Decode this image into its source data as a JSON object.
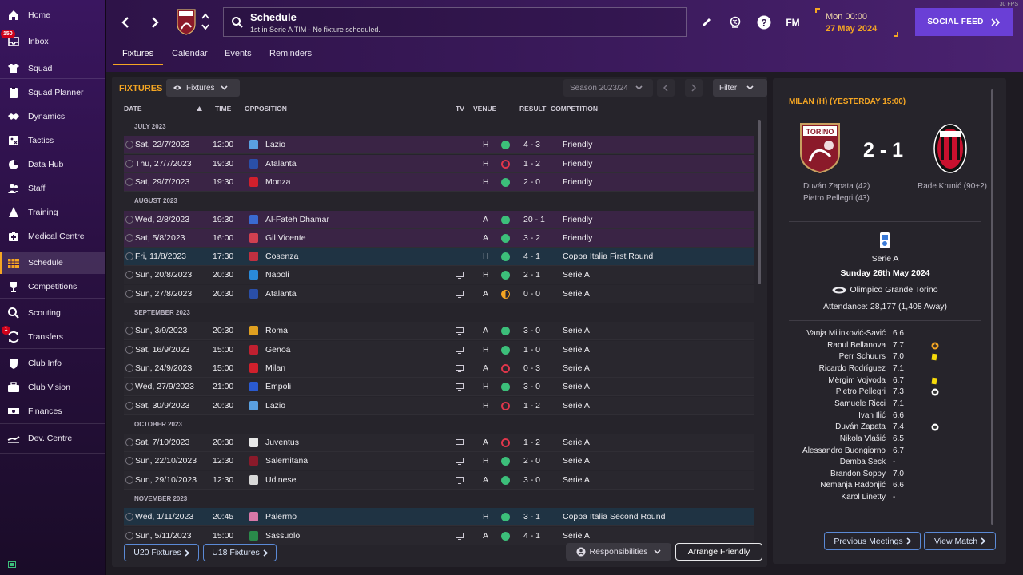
{
  "sidebar": {
    "items": [
      {
        "label": "Home",
        "icon": "home-icon"
      },
      {
        "label": "Inbox",
        "icon": "inbox-icon",
        "badge": "150"
      },
      {
        "label": "Squad",
        "icon": "shirt-icon"
      },
      {
        "label": "Squad Planner",
        "icon": "clipboard-icon"
      },
      {
        "label": "Dynamics",
        "icon": "handshake-icon"
      },
      {
        "label": "Tactics",
        "icon": "tactics-board-icon"
      },
      {
        "label": "Data Hub",
        "icon": "data-hub-icon"
      },
      {
        "label": "Staff",
        "icon": "staff-icon"
      },
      {
        "label": "Training",
        "icon": "training-cone-icon"
      },
      {
        "label": "Medical Centre",
        "icon": "medical-kit-icon"
      },
      {
        "label": "Schedule",
        "icon": "calendar-icon"
      },
      {
        "label": "Competitions",
        "icon": "trophy-icon"
      },
      {
        "label": "Scouting",
        "icon": "magnifier-icon"
      },
      {
        "label": "Transfers",
        "icon": "transfer-arrows-icon",
        "badge": "1"
      },
      {
        "label": "Club Info",
        "icon": "shield-icon"
      },
      {
        "label": "Club Vision",
        "icon": "briefcase-icon"
      },
      {
        "label": "Finances",
        "icon": "money-icon"
      },
      {
        "label": "Dev. Centre",
        "icon": "dev-centre-icon"
      }
    ],
    "active": "Schedule"
  },
  "header": {
    "title": "Schedule",
    "subtitle": "1st in Serie A TIM - No fixture scheduled.",
    "date_time": "Mon 00:00",
    "date": "27 May 2024",
    "social_feed": "SOCIAL FEED",
    "fm_label": "FM",
    "fps": "30 FPS"
  },
  "tabs": [
    "Fixtures",
    "Calendar",
    "Events",
    "Reminders"
  ],
  "fixtures_panel": {
    "title": "FIXTURES",
    "view_dropdown": "Fixtures",
    "season": "Season 2023/24",
    "filter": "Filter",
    "columns": {
      "date": "DATE",
      "time": "TIME",
      "opposition": "OPPOSITION",
      "tv": "TV",
      "venue": "VENUE",
      "result": "RESULT",
      "competition": "COMPETITION"
    },
    "rows": [
      {
        "type": "month",
        "label": "JULY 2023"
      },
      {
        "type": "fixture",
        "style": "friendly",
        "date": "Sat, 22/7/2023",
        "time": "12:00",
        "opposition": "Lazio",
        "crest": "#5aa0e0",
        "tv": false,
        "venue": "H",
        "outcome": "win",
        "result": "4 - 3",
        "competition": "Friendly"
      },
      {
        "type": "fixture",
        "style": "friendly",
        "date": "Thu, 27/7/2023",
        "time": "19:30",
        "opposition": "Atalanta",
        "crest": "#2a4fa8",
        "tv": false,
        "venue": "H",
        "outcome": "loss",
        "result": "1 - 2",
        "competition": "Friendly"
      },
      {
        "type": "fixture",
        "style": "friendly",
        "date": "Sat, 29/7/2023",
        "time": "19:30",
        "opposition": "Monza",
        "crest": "#d0202c",
        "tv": false,
        "venue": "H",
        "outcome": "win",
        "result": "2 - 0",
        "competition": "Friendly"
      },
      {
        "type": "month",
        "label": "AUGUST 2023"
      },
      {
        "type": "fixture",
        "style": "friendly",
        "date": "Wed, 2/8/2023",
        "time": "19:30",
        "opposition": "Al-Fateh Dhamar",
        "crest": "#3a6ad0",
        "tv": false,
        "venue": "A",
        "outcome": "win",
        "result": "20 - 1",
        "competition": "Friendly"
      },
      {
        "type": "fixture",
        "style": "friendly",
        "date": "Sat, 5/8/2023",
        "time": "16:00",
        "opposition": "Gil Vicente",
        "crest": "#d04050",
        "tv": false,
        "venue": "A",
        "outcome": "win",
        "result": "3 - 2",
        "competition": "Friendly"
      },
      {
        "type": "fixture",
        "style": "cup",
        "date": "Fri, 11/8/2023",
        "time": "17:30",
        "opposition": "Cosenza",
        "crest": "#c03040",
        "tv": false,
        "venue": "H",
        "outcome": "win",
        "result": "4 - 1",
        "competition": "Coppa Italia First Round"
      },
      {
        "type": "fixture",
        "style": "league",
        "date": "Sun, 20/8/2023",
        "time": "20:30",
        "opposition": "Napoli",
        "crest": "#2a8ad8",
        "tv": true,
        "venue": "H",
        "outcome": "win",
        "result": "2 - 1",
        "competition": "Serie A"
      },
      {
        "type": "fixture",
        "style": "league",
        "date": "Sun, 27/8/2023",
        "time": "20:30",
        "opposition": "Atalanta",
        "crest": "#2a4fa8",
        "tv": true,
        "venue": "A",
        "outcome": "draw",
        "result": "0 - 0",
        "competition": "Serie A"
      },
      {
        "type": "month",
        "label": "SEPTEMBER 2023"
      },
      {
        "type": "fixture",
        "style": "league",
        "date": "Sun, 3/9/2023",
        "time": "20:30",
        "opposition": "Roma",
        "crest": "#e0a020",
        "tv": true,
        "venue": "A",
        "outcome": "win",
        "result": "3 - 0",
        "competition": "Serie A"
      },
      {
        "type": "fixture",
        "style": "league",
        "date": "Sat, 16/9/2023",
        "time": "15:00",
        "opposition": "Genoa",
        "crest": "#c02030",
        "tv": true,
        "venue": "H",
        "outcome": "win",
        "result": "1 - 0",
        "competition": "Serie A"
      },
      {
        "type": "fixture",
        "style": "league",
        "date": "Sun, 24/9/2023",
        "time": "15:00",
        "opposition": "Milan",
        "crest": "#d0202c",
        "tv": true,
        "venue": "A",
        "outcome": "loss",
        "result": "0 - 3",
        "competition": "Serie A"
      },
      {
        "type": "fixture",
        "style": "league",
        "date": "Wed, 27/9/2023",
        "time": "21:00",
        "opposition": "Empoli",
        "crest": "#2a5ad0",
        "tv": true,
        "venue": "H",
        "outcome": "win",
        "result": "3 - 0",
        "competition": "Serie A"
      },
      {
        "type": "fixture",
        "style": "league",
        "date": "Sat, 30/9/2023",
        "time": "20:30",
        "opposition": "Lazio",
        "crest": "#5aa0e0",
        "tv": false,
        "venue": "H",
        "outcome": "loss",
        "result": "1 - 2",
        "competition": "Serie A"
      },
      {
        "type": "month",
        "label": "OCTOBER 2023"
      },
      {
        "type": "fixture",
        "style": "league",
        "date": "Sat, 7/10/2023",
        "time": "20:30",
        "opposition": "Juventus",
        "crest": "#e8e8e8",
        "tv": true,
        "venue": "A",
        "outcome": "loss",
        "result": "1 - 2",
        "competition": "Serie A"
      },
      {
        "type": "fixture",
        "style": "league",
        "date": "Sun, 22/10/2023",
        "time": "12:30",
        "opposition": "Salernitana",
        "crest": "#8a1a2a",
        "tv": true,
        "venue": "H",
        "outcome": "win",
        "result": "2 - 0",
        "competition": "Serie A"
      },
      {
        "type": "fixture",
        "style": "league",
        "date": "Sun, 29/10/2023",
        "time": "12:30",
        "opposition": "Udinese",
        "crest": "#d8d8d8",
        "tv": true,
        "venue": "A",
        "outcome": "win",
        "result": "3 - 0",
        "competition": "Serie A"
      },
      {
        "type": "month",
        "label": "NOVEMBER 2023"
      },
      {
        "type": "fixture",
        "style": "cup",
        "date": "Wed, 1/11/2023",
        "time": "20:45",
        "opposition": "Palermo",
        "crest": "#d878a8",
        "tv": false,
        "venue": "H",
        "outcome": "win",
        "result": "3 - 1",
        "competition": "Coppa Italia Second Round"
      },
      {
        "type": "fixture",
        "style": "league",
        "date": "Sun, 5/11/2023",
        "time": "15:00",
        "opposition": "Sassuolo",
        "crest": "#2a8a4a",
        "tv": true,
        "venue": "A",
        "outcome": "win",
        "result": "4 - 1",
        "competition": "Serie A"
      }
    ],
    "buttons": {
      "u20": "U20 Fixtures",
      "u18": "U18 Fixtures",
      "responsibilities": "Responsibilities",
      "arrange": "Arrange Friendly"
    }
  },
  "match_panel": {
    "title": "MILAN (H) (YESTERDAY 15:00)",
    "home_crest_text": "TORINO",
    "score": "2 - 1",
    "home_scorers": [
      "Duván Zapata (42)",
      "Pietro Pellegri (43)"
    ],
    "away_scorers": [
      "Rade Krunić (90+2)"
    ],
    "competition": "Serie A",
    "match_date": "Sunday 26th May 2024",
    "stadium": "Olimpico Grande Torino",
    "attendance": "Attendance: 28,177 (1,408 Away)",
    "players": [
      {
        "name": "Vanja Milinković-Savić",
        "rating": "6.6",
        "event": ""
      },
      {
        "name": "Raoul Bellanova",
        "rating": "7.7",
        "event": "assist"
      },
      {
        "name": "Perr Schuurs",
        "rating": "7.0",
        "event": "yellow-card"
      },
      {
        "name": "Ricardo Rodríguez",
        "rating": "7.1",
        "event": ""
      },
      {
        "name": "Mërgim Vojvoda",
        "rating": "6.7",
        "event": "yellow-card"
      },
      {
        "name": "Pietro Pellegri",
        "rating": "7.3",
        "event": "goal"
      },
      {
        "name": "Samuele Ricci",
        "rating": "7.1",
        "event": ""
      },
      {
        "name": "Ivan Ilić",
        "rating": "6.6",
        "event": ""
      },
      {
        "name": "Duván Zapata",
        "rating": "7.4",
        "event": "goal"
      },
      {
        "name": "Nikola Vlašić",
        "rating": "6.5",
        "event": ""
      },
      {
        "name": "Alessandro Buongiorno",
        "rating": "6.7",
        "event": ""
      },
      {
        "name": "Demba Seck",
        "rating": "-",
        "event": ""
      },
      {
        "name": "Brandon Soppy",
        "rating": "7.0",
        "event": ""
      },
      {
        "name": "Nemanja Radonjić",
        "rating": "6.6",
        "event": ""
      },
      {
        "name": "Karol Linetty",
        "rating": "-",
        "event": ""
      }
    ],
    "previous_meetings": "Previous Meetings",
    "view_match": "View Match"
  },
  "colors": {
    "accent": "#f5a623",
    "win": "#3cbf7a",
    "loss": "#e0364b",
    "social": "#6a3fd6",
    "link_border": "#5b8ad6"
  }
}
